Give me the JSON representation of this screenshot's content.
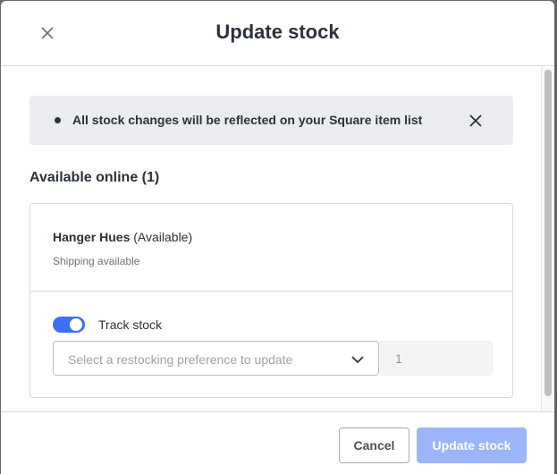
{
  "dialog": {
    "title": "Update stock",
    "close_icon": "close-icon"
  },
  "banner": {
    "text": "All stock changes will be reflected on your Square item list",
    "bullet_icon": "bullet-icon",
    "close_icon": "close-icon"
  },
  "section": {
    "title": "Available online (1)"
  },
  "item": {
    "name": "Hanger Hues",
    "status": "(Available)",
    "subtitle": "Shipping available",
    "track_stock": {
      "label": "Track stock",
      "enabled": true
    },
    "restock_select": {
      "placeholder": "Select a restocking preference to update",
      "icon": "chevron-down-icon"
    },
    "quantity": "1"
  },
  "footer": {
    "cancel_label": "Cancel",
    "update_label": "Update stock"
  },
  "colors": {
    "accent": "#3d6ff5",
    "accent_disabled": "#9bb5f8",
    "banner_bg": "#ebecef",
    "text": "#2b323b"
  }
}
